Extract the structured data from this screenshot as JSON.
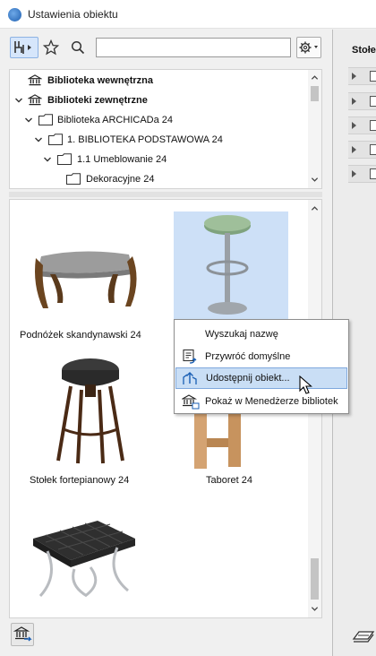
{
  "window": {
    "title": "Ustawienia obiektu"
  },
  "search": {
    "value": "",
    "placeholder": ""
  },
  "right_panel": {
    "label": "Stołek"
  },
  "tree": {
    "items": [
      {
        "label": "Biblioteka wewnętrzna",
        "bold": true
      },
      {
        "label": "Biblioteki zewnętrzne",
        "bold": true
      },
      {
        "label": "Biblioteka ARCHICADa 24",
        "bold": false
      },
      {
        "label": "1. BIBLIOTEKA PODSTAWOWA 24",
        "bold": false
      },
      {
        "label": "1.1 Umeblowanie 24",
        "bold": false
      },
      {
        "label": "Dekoracyjne 24",
        "bold": false
      }
    ]
  },
  "grid": {
    "items": [
      {
        "caption": "Podnóżek skandynawski 24"
      },
      {
        "caption": ""
      },
      {
        "caption": "Stołek fortepianowy 24"
      },
      {
        "caption": "Taboret 24"
      },
      {
        "caption": ""
      }
    ]
  },
  "context_menu": {
    "items": [
      {
        "label": "Wyszukaj nazwę",
        "icon": "none"
      },
      {
        "label": "Przywróć domyślne",
        "icon": "restore-icon"
      },
      {
        "label": "Udostępnij obiekt...",
        "icon": "share-icon",
        "highlighted": true
      },
      {
        "label": "Pokaż w Menedżerze bibliotek",
        "icon": "library-manager-icon"
      }
    ]
  }
}
